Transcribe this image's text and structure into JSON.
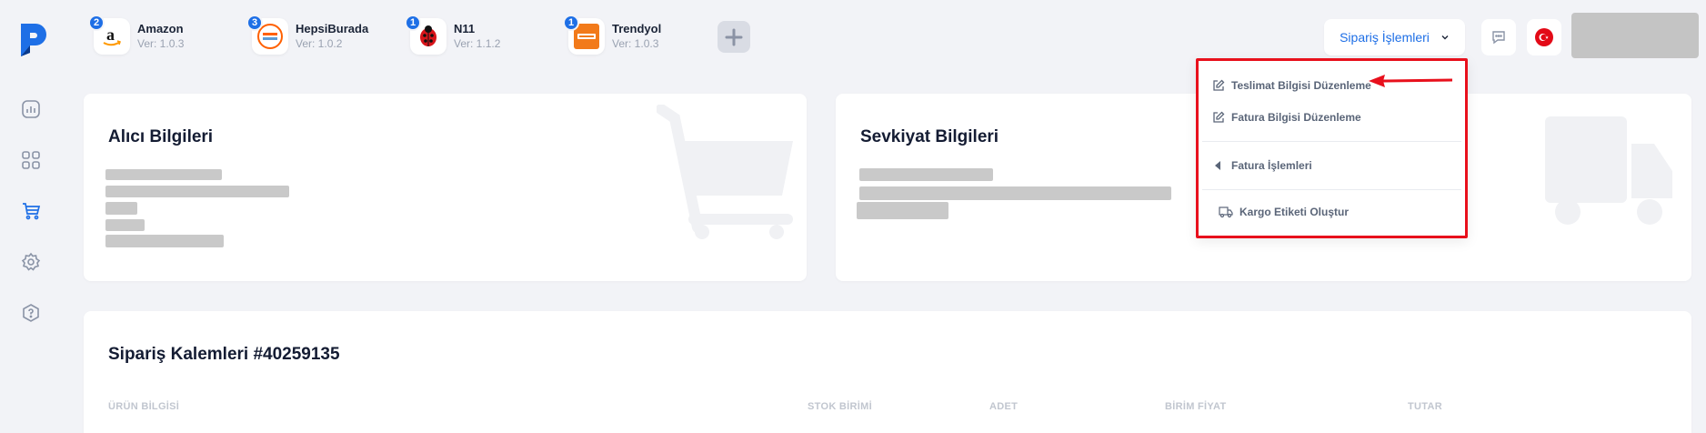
{
  "sidebar": {
    "items": [
      {
        "name": "dashboard-icon"
      },
      {
        "name": "apps-icon"
      },
      {
        "name": "cart-icon"
      },
      {
        "name": "settings-icon"
      },
      {
        "name": "help-icon"
      }
    ]
  },
  "marketplaces": [
    {
      "name": "Amazon",
      "version": "Ver: 1.0.3",
      "badge": "2"
    },
    {
      "name": "HepsiBurada",
      "version": "Ver: 1.0.2",
      "badge": "3"
    },
    {
      "name": "N11",
      "version": "Ver: 1.1.2",
      "badge": "1"
    },
    {
      "name": "Trendyol",
      "version": "Ver: 1.0.3",
      "badge": "1"
    }
  ],
  "header": {
    "orders_button": "Sipariş İşlemleri"
  },
  "dropdown": {
    "items": [
      "Teslimat Bilgisi Düzenleme",
      "Fatura Bilgisi Düzenleme",
      "Fatura İşlemleri",
      "Kargo Etiketi Oluştur"
    ]
  },
  "buyer_card": {
    "title": "Alıcı Bilgileri"
  },
  "shipment_card": {
    "title": "Sevkiyat Bilgileri"
  },
  "items_card": {
    "title": "Sipariş Kalemleri #40259135",
    "columns": [
      "ÜRÜN BİLGİSİ",
      "STOK BİRİMİ",
      "ADET",
      "BİRİM FİYAT",
      "TUTAR"
    ]
  },
  "colors": {
    "accent": "#1e6fe6",
    "highlight_border": "#e8101c",
    "background": "#f2f3f7"
  }
}
